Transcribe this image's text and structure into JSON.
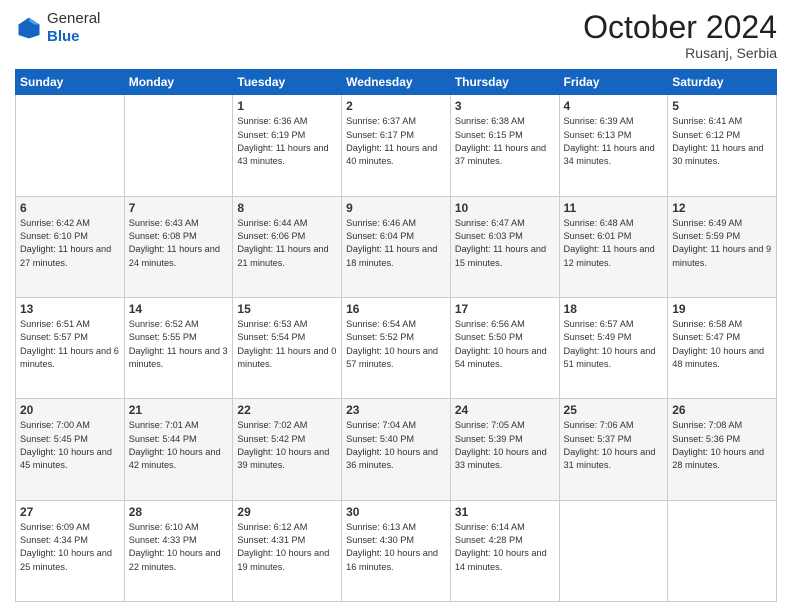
{
  "header": {
    "logo_line1": "General",
    "logo_line2": "Blue",
    "month": "October 2024",
    "location": "Rusanj, Serbia"
  },
  "weekdays": [
    "Sunday",
    "Monday",
    "Tuesday",
    "Wednesday",
    "Thursday",
    "Friday",
    "Saturday"
  ],
  "weeks": [
    [
      {
        "day": "",
        "info": ""
      },
      {
        "day": "",
        "info": ""
      },
      {
        "day": "1",
        "info": "Sunrise: 6:36 AM\nSunset: 6:19 PM\nDaylight: 11 hours and 43 minutes."
      },
      {
        "day": "2",
        "info": "Sunrise: 6:37 AM\nSunset: 6:17 PM\nDaylight: 11 hours and 40 minutes."
      },
      {
        "day": "3",
        "info": "Sunrise: 6:38 AM\nSunset: 6:15 PM\nDaylight: 11 hours and 37 minutes."
      },
      {
        "day": "4",
        "info": "Sunrise: 6:39 AM\nSunset: 6:13 PM\nDaylight: 11 hours and 34 minutes."
      },
      {
        "day": "5",
        "info": "Sunrise: 6:41 AM\nSunset: 6:12 PM\nDaylight: 11 hours and 30 minutes."
      }
    ],
    [
      {
        "day": "6",
        "info": "Sunrise: 6:42 AM\nSunset: 6:10 PM\nDaylight: 11 hours and 27 minutes."
      },
      {
        "day": "7",
        "info": "Sunrise: 6:43 AM\nSunset: 6:08 PM\nDaylight: 11 hours and 24 minutes."
      },
      {
        "day": "8",
        "info": "Sunrise: 6:44 AM\nSunset: 6:06 PM\nDaylight: 11 hours and 21 minutes."
      },
      {
        "day": "9",
        "info": "Sunrise: 6:46 AM\nSunset: 6:04 PM\nDaylight: 11 hours and 18 minutes."
      },
      {
        "day": "10",
        "info": "Sunrise: 6:47 AM\nSunset: 6:03 PM\nDaylight: 11 hours and 15 minutes."
      },
      {
        "day": "11",
        "info": "Sunrise: 6:48 AM\nSunset: 6:01 PM\nDaylight: 11 hours and 12 minutes."
      },
      {
        "day": "12",
        "info": "Sunrise: 6:49 AM\nSunset: 5:59 PM\nDaylight: 11 hours and 9 minutes."
      }
    ],
    [
      {
        "day": "13",
        "info": "Sunrise: 6:51 AM\nSunset: 5:57 PM\nDaylight: 11 hours and 6 minutes."
      },
      {
        "day": "14",
        "info": "Sunrise: 6:52 AM\nSunset: 5:55 PM\nDaylight: 11 hours and 3 minutes."
      },
      {
        "day": "15",
        "info": "Sunrise: 6:53 AM\nSunset: 5:54 PM\nDaylight: 11 hours and 0 minutes."
      },
      {
        "day": "16",
        "info": "Sunrise: 6:54 AM\nSunset: 5:52 PM\nDaylight: 10 hours and 57 minutes."
      },
      {
        "day": "17",
        "info": "Sunrise: 6:56 AM\nSunset: 5:50 PM\nDaylight: 10 hours and 54 minutes."
      },
      {
        "day": "18",
        "info": "Sunrise: 6:57 AM\nSunset: 5:49 PM\nDaylight: 10 hours and 51 minutes."
      },
      {
        "day": "19",
        "info": "Sunrise: 6:58 AM\nSunset: 5:47 PM\nDaylight: 10 hours and 48 minutes."
      }
    ],
    [
      {
        "day": "20",
        "info": "Sunrise: 7:00 AM\nSunset: 5:45 PM\nDaylight: 10 hours and 45 minutes."
      },
      {
        "day": "21",
        "info": "Sunrise: 7:01 AM\nSunset: 5:44 PM\nDaylight: 10 hours and 42 minutes."
      },
      {
        "day": "22",
        "info": "Sunrise: 7:02 AM\nSunset: 5:42 PM\nDaylight: 10 hours and 39 minutes."
      },
      {
        "day": "23",
        "info": "Sunrise: 7:04 AM\nSunset: 5:40 PM\nDaylight: 10 hours and 36 minutes."
      },
      {
        "day": "24",
        "info": "Sunrise: 7:05 AM\nSunset: 5:39 PM\nDaylight: 10 hours and 33 minutes."
      },
      {
        "day": "25",
        "info": "Sunrise: 7:06 AM\nSunset: 5:37 PM\nDaylight: 10 hours and 31 minutes."
      },
      {
        "day": "26",
        "info": "Sunrise: 7:08 AM\nSunset: 5:36 PM\nDaylight: 10 hours and 28 minutes."
      }
    ],
    [
      {
        "day": "27",
        "info": "Sunrise: 6:09 AM\nSunset: 4:34 PM\nDaylight: 10 hours and 25 minutes."
      },
      {
        "day": "28",
        "info": "Sunrise: 6:10 AM\nSunset: 4:33 PM\nDaylight: 10 hours and 22 minutes."
      },
      {
        "day": "29",
        "info": "Sunrise: 6:12 AM\nSunset: 4:31 PM\nDaylight: 10 hours and 19 minutes."
      },
      {
        "day": "30",
        "info": "Sunrise: 6:13 AM\nSunset: 4:30 PM\nDaylight: 10 hours and 16 minutes."
      },
      {
        "day": "31",
        "info": "Sunrise: 6:14 AM\nSunset: 4:28 PM\nDaylight: 10 hours and 14 minutes."
      },
      {
        "day": "",
        "info": ""
      },
      {
        "day": "",
        "info": ""
      }
    ]
  ]
}
